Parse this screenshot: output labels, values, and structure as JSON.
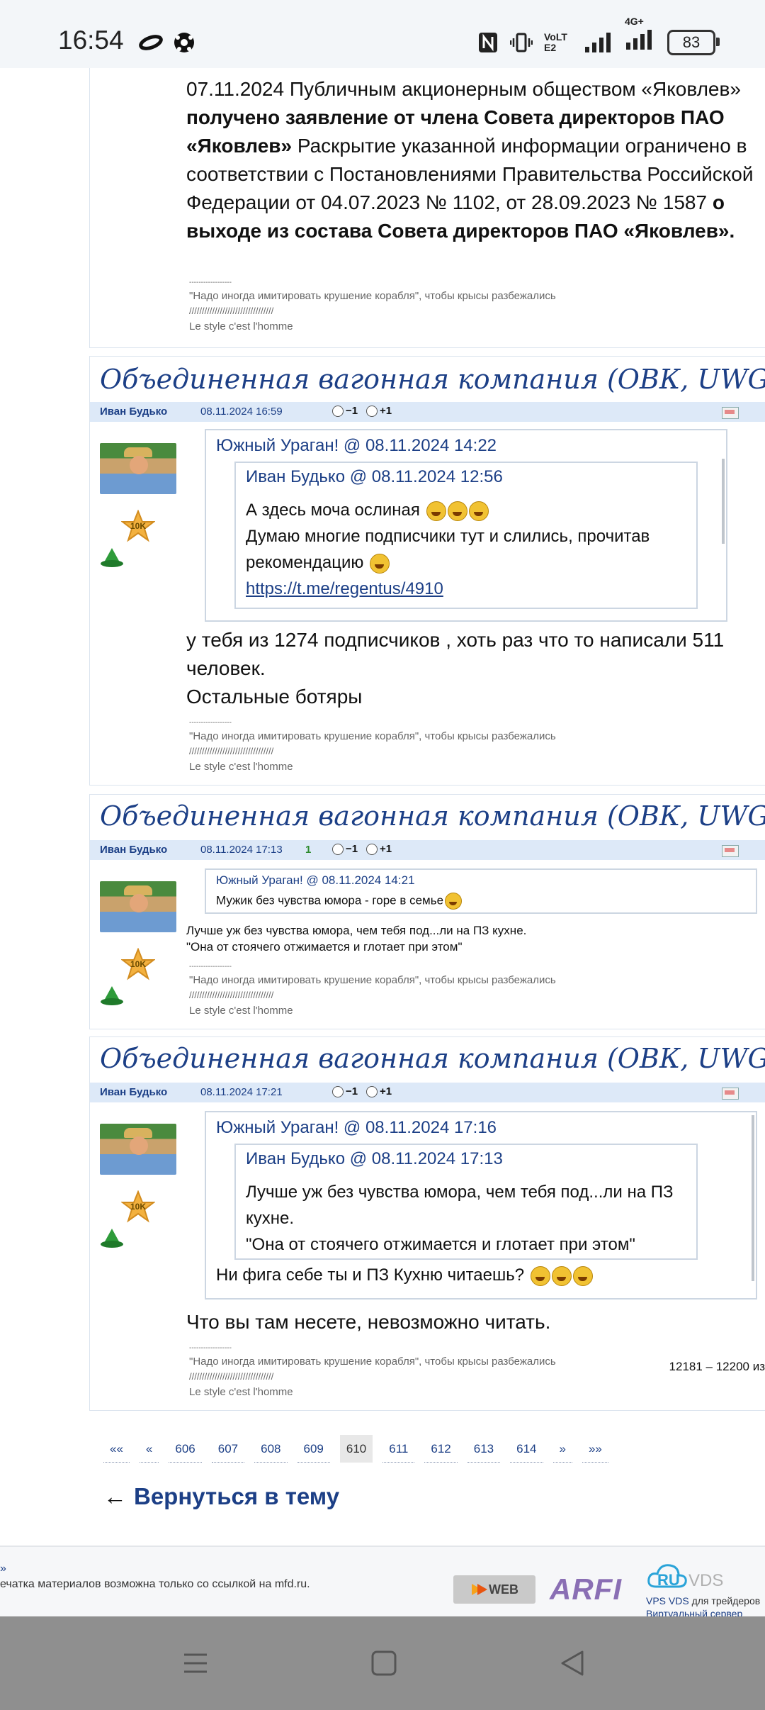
{
  "status_bar": {
    "time": "16:54",
    "network_label": "VoLTE2",
    "network_type": "4G+",
    "battery": "83",
    "icons": [
      "infinity-icon",
      "soccer-ball-icon",
      "nfc-icon",
      "vibrate-icon",
      "signal-icon",
      "battery-icon"
    ]
  },
  "top_post": {
    "body_parts": [
      {
        "text": "07.11.2024 Публичным акционерным обществом «Яковлев» ",
        "bold": false
      },
      {
        "text": "получено заявление от члена Совета директоров ПАО «Яковлев»",
        "bold": true
      },
      {
        "text": " Раскрытие указанной информации ограничено в соответствии с Постановлениями Правительства Российской Федерации от 04.07.2023 № 1102, от 28.09.2023 № 1587 ",
        "bold": false
      },
      {
        "text": "о выходе из состава Совета директоров ПАО «Яковлев».",
        "bold": true
      }
    ],
    "sig_line1": "\"Надо иногда имитировать крушение корабля\", чтобы крысы разбежались",
    "sig_line2": "/////////////////////////////////",
    "sig_line3": "Le style c'est l'homme"
  },
  "posts": [
    {
      "title": "Объединенная вагонная компания (ОВК, UWGN)",
      "author": "Иван Будько",
      "date": "08.11.2024 16:59",
      "rating": "",
      "vote_minus": "−1",
      "vote_plus": "+1",
      "badge": "10K",
      "quote_author": "Южный Ураган!",
      "quote_date": "08.11.2024 14:22",
      "inner_author": "Иван Будько",
      "inner_date": "08.11.2024 12:56",
      "inner_line1": "А здесь моча ослиная",
      "inner_line2": "Думаю многие подписчики тут и слились, прочитав рекомендацию",
      "inner_link": "https://t.me/regentus/4910",
      "body_line1": "у тебя из 1274 подписчиков , хоть раз что то написали 511 человек.",
      "body_line2": "Остальные ботяры"
    },
    {
      "title": "Объединенная вагонная компания (ОВК, UWGN)",
      "author": "Иван Будько",
      "date": "08.11.2024 17:13",
      "rating": "1",
      "vote_minus": "−1",
      "vote_plus": "+1",
      "badge": "10K",
      "quote_author": "Южный Ураган!",
      "quote_date": "08.11.2024 14:21",
      "quote_text": "Мужик без чувства юмора - горе в семье",
      "body_line1": "Лучше уж без чувства юмора, чем тебя под...ли на ПЗ кухне.",
      "body_line2": "\"Она от стоячего отжимается и глотает при этом\""
    },
    {
      "title": "Объединенная вагонная компания (ОВК, UWGN)",
      "author": "Иван Будько",
      "date": "08.11.2024 17:21",
      "rating": "",
      "vote_minus": "−1",
      "vote_plus": "+1",
      "badge": "10K",
      "quote_author": "Южный Ураган!",
      "quote_date": "08.11.2024 17:16",
      "inner_author": "Иван Будько",
      "inner_date": "08.11.2024 17:13",
      "inner_line1": "Лучше уж без чувства юмора, чем тебя под...ли на ПЗ кухне.",
      "inner_line2": "\"Она от стоячего отжимается и глотает при этом\"",
      "quote_text": "Ни фига себе ты и ПЗ Кухню читаешь?",
      "body_line1": "Что вы там несете, невозможно читать."
    }
  ],
  "signature": {
    "divider": "------------------",
    "line1": "\"Надо иногда имитировать крушение корабля\", чтобы крысы разбежались",
    "line2": "/////////////////////////////////",
    "line3": "Le style c'est l'homme"
  },
  "pager": {
    "count": "12181 – 12200 из",
    "first": "««",
    "prev": "«",
    "pages": [
      "606",
      "607",
      "608",
      "609",
      "610",
      "611",
      "612",
      "613",
      "614"
    ],
    "current": "610",
    "next": "»",
    "last": "»»"
  },
  "back": {
    "arrow": "←",
    "label": "Вернуться в тему"
  },
  "footer": {
    "dot": "»",
    "text": "ечатка материалов возможна только со ссылкой на mfd.ru.",
    "logo_web": "WEB",
    "logo_arfi": "ARFI",
    "ru": "RU",
    "vds": "VDS",
    "ruvds_line1_link": "VPS VDS",
    "ruvds_line1_text": " для трейдеров",
    "ruvds_line2": "Виртуальный сервер"
  },
  "colors": {
    "link": "#1c3f86",
    "meta_bar": "#dde9f8",
    "nav_bar": "#8f8f8f"
  }
}
